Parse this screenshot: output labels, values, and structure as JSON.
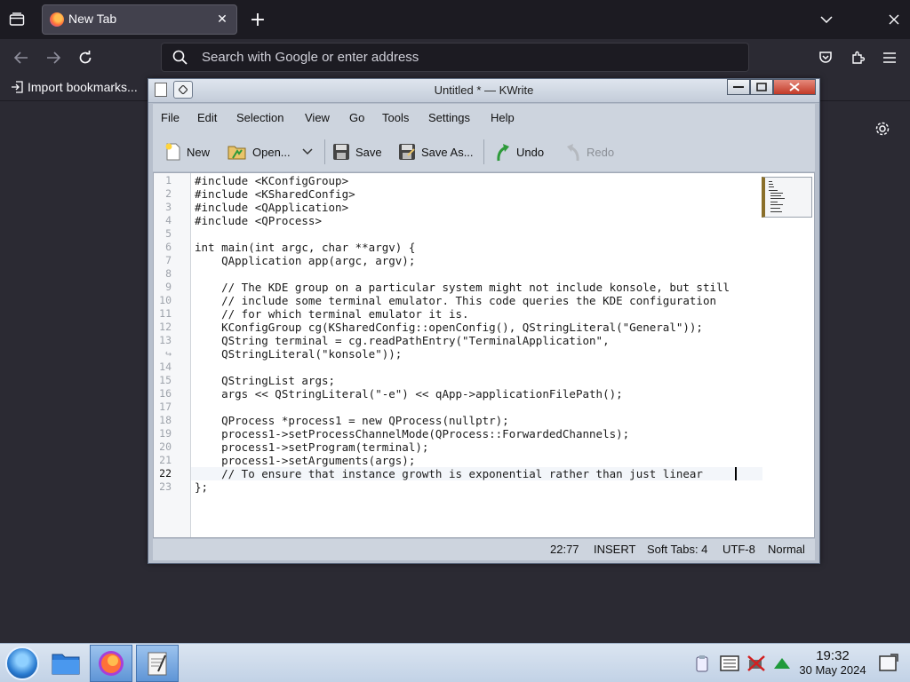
{
  "browser": {
    "tab_title": "New Tab",
    "url_placeholder": "Search with Google or enter address",
    "bookmark_import": "Import bookmarks..."
  },
  "kwrite": {
    "title": "Untitled * — KWrite",
    "menu": [
      "File",
      "Edit",
      "Selection",
      "View",
      "Go",
      "Tools",
      "Settings",
      "Help"
    ],
    "toolbar": {
      "new": "New",
      "open": "Open...",
      "save": "Save",
      "save_as": "Save As...",
      "undo": "Undo",
      "redo": "Redo"
    },
    "line_numbers": [
      "1",
      "2",
      "3",
      "4",
      "5",
      "6",
      "7",
      "8",
      "9",
      "10",
      "11",
      "12",
      "13",
      "↪",
      "14",
      "15",
      "16",
      "17",
      "18",
      "19",
      "20",
      "21",
      "22",
      "23"
    ],
    "code_lines": [
      "#include <KConfigGroup>",
      "#include <KSharedConfig>",
      "#include <QApplication>",
      "#include <QProcess>",
      "",
      "int main(int argc, char **argv) {",
      "    QApplication app(argc, argv);",
      "",
      "    // The KDE group on a particular system might not include konsole, but still",
      "    // include some terminal emulator. This code queries the KDE configuration",
      "    // for which terminal emulator it is.",
      "    KConfigGroup cg(KSharedConfig::openConfig(), QStringLiteral(\"General\"));",
      "    QString terminal = cg.readPathEntry(\"TerminalApplication\",",
      "    QStringLiteral(\"konsole\"));",
      "",
      "    QStringList args;",
      "    args << QStringLiteral(\"-e\") << qApp->applicationFilePath();",
      "",
      "    QProcess *process1 = new QProcess(nullptr);",
      "    process1->setProcessChannelMode(QProcess::ForwardedChannels);",
      "    process1->setProgram(terminal);",
      "    process1->setArguments(args);",
      "    // To ensure that instance growth is exponential rather than just linear",
      "};"
    ],
    "current_line_index": 22,
    "status": {
      "position": "22:77",
      "mode": "INSERT",
      "tabs": "Soft Tabs: 4",
      "encoding": "UTF-8",
      "view": "Normal"
    }
  },
  "taskbar": {
    "time": "19:32",
    "date": "30 May 2024"
  }
}
